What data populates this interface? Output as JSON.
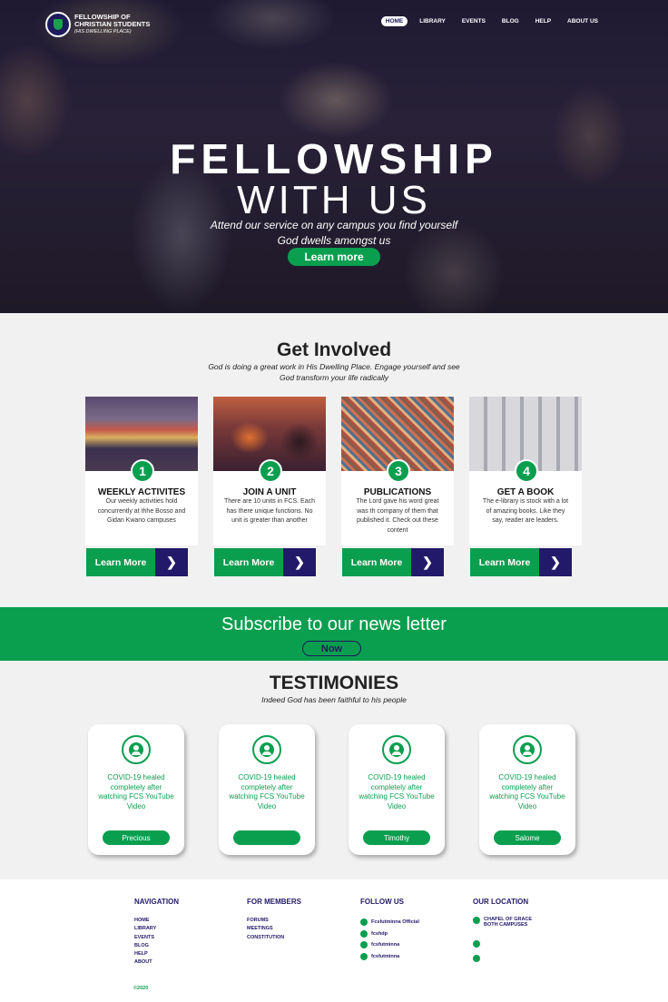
{
  "brand": {
    "line1": "FELLOWSHIP OF",
    "line2": "CHRISTIAN STUDENTS",
    "line3": "(HIS DWELLING PLACE)"
  },
  "nav": [
    "HOME",
    "LIBRARY",
    "EVENTS",
    "BLOG",
    "HELP",
    "ABOUT US"
  ],
  "hero": {
    "title1": "FELLOWSHIP",
    "title2": "WITH US",
    "sub1": "Attend our service on any campus you find yourself",
    "sub2": "God dwells amongst us",
    "button": "Learn more"
  },
  "involved": {
    "title": "Get Involved",
    "subtitle": "God is doing a great work in His Dwelling Place. Engage yourself and see God transform your life radically",
    "cards": [
      {
        "num": "1",
        "title": "WEEKLY ACTIVITES",
        "text": "Our weekly activities hold concurrently at thhe Bosso and Gidan Kwano campuses",
        "button": "Learn More",
        "arrow": "❯"
      },
      {
        "num": "2",
        "title": "JOIN A UNIT",
        "text": "There are 10 units in FCS. Each has there unique functions. No unit is greater than another",
        "button": "Learn More",
        "arrow": "❯"
      },
      {
        "num": "3",
        "title": "PUBLICATIONS",
        "text": "The Lord gave his word great was th company of them that published it. Check out these content",
        "button": "Learn More",
        "arrow": "❯"
      },
      {
        "num": "4",
        "title": "GET A BOOK",
        "text": "The e-library is stock with a lot of amazing books. Like they say, reader are leaders.",
        "button": "Learn More",
        "arrow": "❯"
      }
    ]
  },
  "subscribe": {
    "title": "Subscribe to our news letter",
    "button": "Now"
  },
  "testimonies": {
    "title": "TESTIMONIES",
    "subtitle": "Indeed God has been faithful to his people",
    "items": [
      {
        "text": "COVID-19 healed completely after watching FCS YouTube Video",
        "name": "Precious"
      },
      {
        "text": "COVID-19 healed completely after watching FCS YouTube Video",
        "name": ""
      },
      {
        "text": "COVID-19 healed completely after watching FCS YouTube Video",
        "name": "Timothy"
      },
      {
        "text": "COVID-19 healed completely after watching FCS YouTube Video",
        "name": "Salome"
      }
    ]
  },
  "footer": {
    "navigation": {
      "title": "NAVIGATION",
      "links": [
        "HOME",
        "LIBRARY",
        "EVENTS",
        "BLOG",
        "HELP",
        "ABOUT"
      ]
    },
    "members": {
      "title": "FOR MEMBERS",
      "links": [
        "FORUMS",
        "MEETINGS",
        "CONSTITUTION"
      ]
    },
    "follow": {
      "title": "FOLLOW US",
      "items": [
        "Fcsfutminna Official",
        "fcshdp",
        "fcsfutminna",
        "fcsfutminna"
      ]
    },
    "location": {
      "title": "OUR LOCATION",
      "address": "CHAPEL OF GRACE BOTH CAMPUSES"
    },
    "copyright": "©2020"
  },
  "colors": {
    "green": "#0a9f4f",
    "navy": "#22196b"
  }
}
